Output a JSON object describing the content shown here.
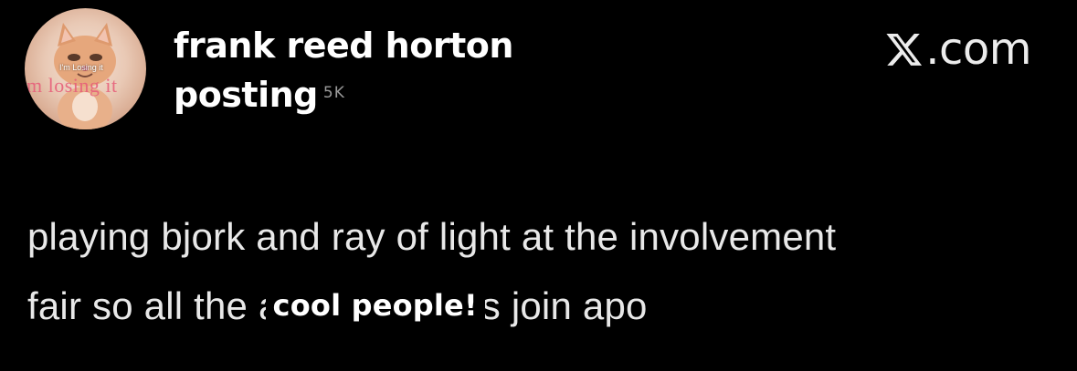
{
  "avatar": {
    "icon": "cat-avatar",
    "caption_small": "I'm Losing it",
    "caption_large": "m losing it"
  },
  "author": {
    "name_line1": "frank reed horton",
    "name_line2": "posting",
    "meta_fragment": "5K"
  },
  "brand": {
    "icon": "x-logo-icon",
    "suffix": ".com"
  },
  "post": {
    "line1": "playing bjork and ray of light at the involvement",
    "line2_start": "fair so all the a",
    "sticker_text": "cool people!",
    "line2_end": "s join apo"
  },
  "colors": {
    "background": "#000000",
    "text": "#e8e8e8",
    "muted": "#9a9a9a",
    "avatar_caption": "#e7607a"
  }
}
